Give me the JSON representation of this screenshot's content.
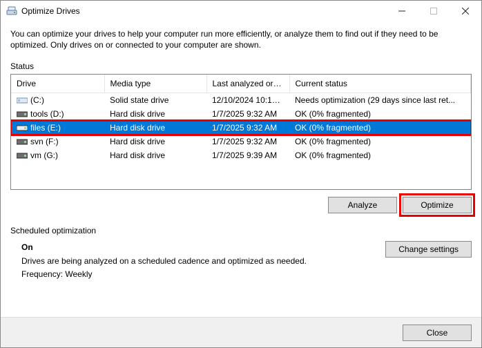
{
  "window": {
    "title": "Optimize Drives"
  },
  "intro": "You can optimize your drives to help your computer run more efficiently, or analyze them to find out if they need to be optimized. Only drives on or connected to your computer are shown.",
  "status_label": "Status",
  "columns": {
    "drive": "Drive",
    "media": "Media type",
    "last": "Last analyzed or o...",
    "current": "Current status"
  },
  "drives": [
    {
      "name": "(C:)",
      "media": "Solid state drive",
      "last": "12/10/2024 10:15 A...",
      "status": "Needs optimization (29 days since last ret..."
    },
    {
      "name": "tools (D:)",
      "media": "Hard disk drive",
      "last": "1/7/2025 9:32 AM",
      "status": "OK (0% fragmented)"
    },
    {
      "name": "files (E:)",
      "media": "Hard disk drive",
      "last": "1/7/2025 9:32 AM",
      "status": "OK (0% fragmented)"
    },
    {
      "name": "svn (F:)",
      "media": "Hard disk drive",
      "last": "1/7/2025 9:32 AM",
      "status": "OK (0% fragmented)"
    },
    {
      "name": "vm (G:)",
      "media": "Hard disk drive",
      "last": "1/7/2025 9:39 AM",
      "status": "OK (0% fragmented)"
    }
  ],
  "buttons": {
    "analyze": "Analyze",
    "optimize": "Optimize",
    "change": "Change settings",
    "close": "Close"
  },
  "sched": {
    "heading": "Scheduled optimization",
    "state": "On",
    "desc": "Drives are being analyzed on a scheduled cadence and optimized as needed.",
    "freq": "Frequency: Weekly"
  }
}
